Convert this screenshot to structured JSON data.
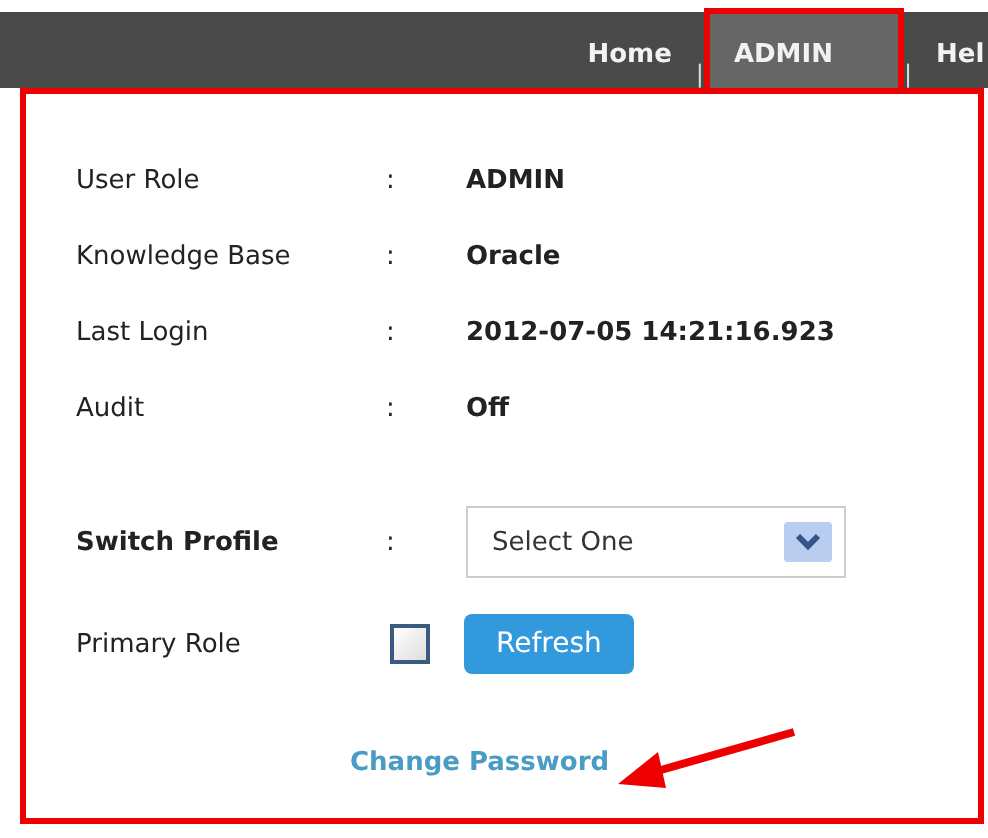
{
  "nav": [
    {
      "kind": "tab",
      "label": "Home",
      "selected": false
    },
    {
      "kind": "separator",
      "label": "|"
    },
    {
      "kind": "tab",
      "label": "ADMIN",
      "selected": true
    },
    {
      "kind": "separator",
      "label": "|"
    },
    {
      "kind": "tab",
      "label": "Hel",
      "selected": false
    }
  ],
  "fields": [
    {
      "label": "User Role",
      "separator": ":",
      "value": "ADMIN"
    },
    {
      "label": "Knowledge Base",
      "separator": ":",
      "value": "Oracle"
    },
    {
      "label": "Last Login",
      "separator": ":",
      "value": "2012-07-05 14:21:16.923"
    },
    {
      "label": "Audit",
      "separator": ":",
      "value": "Off"
    }
  ],
  "switch_profile": {
    "label": "Switch Profile",
    "separator": ":",
    "placeholder": "Select One"
  },
  "primary_role": {
    "label": "Primary Role",
    "checked": false,
    "button": "Refresh"
  },
  "link": "Change Password"
}
